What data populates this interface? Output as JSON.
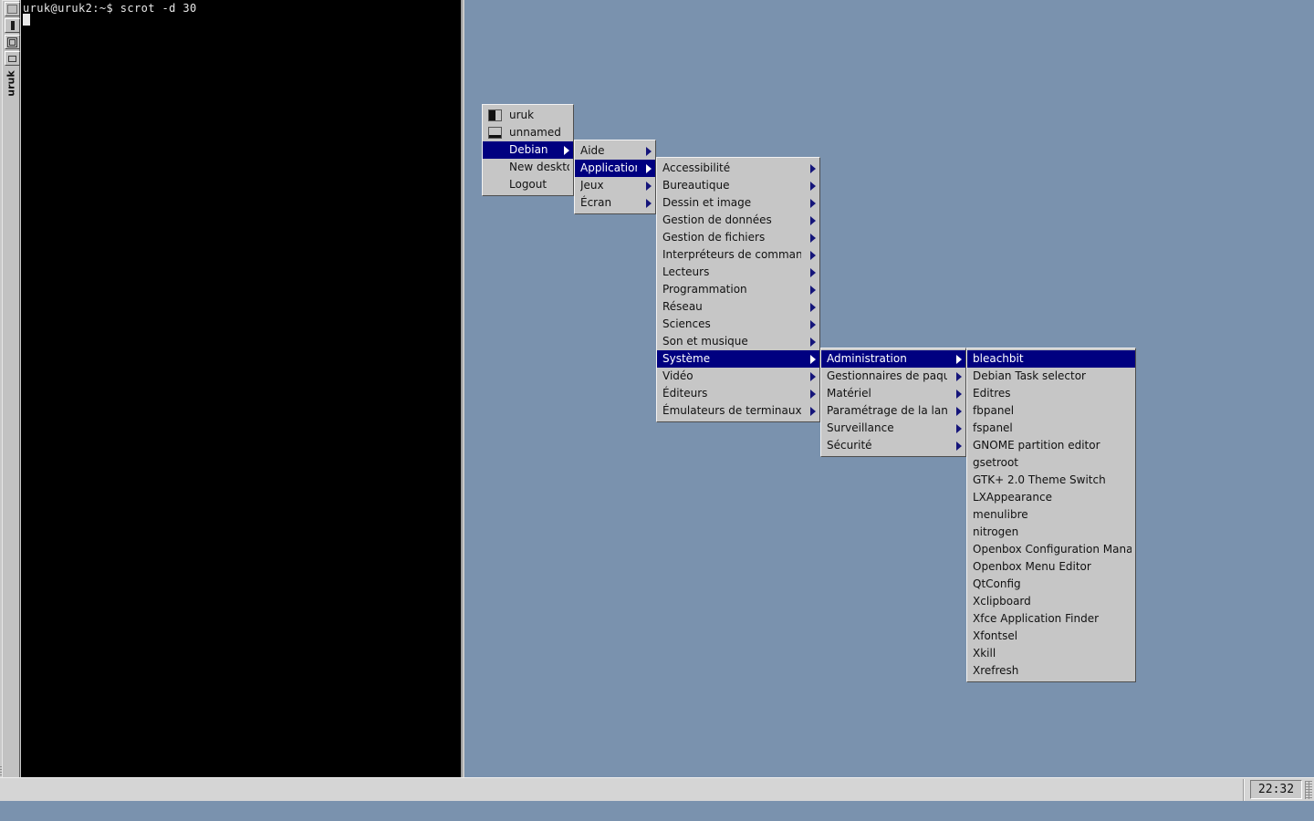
{
  "desktop": {
    "background_color": "#7a92ae"
  },
  "terminal": {
    "title": "uruk",
    "prompt_line": "uruk@uruk2:~$ scrot -d 30",
    "decorations": {
      "menu_button": "window-menu",
      "iconify_button": "iconify",
      "maximize_button": "maximize",
      "shade_button": "shade",
      "close_button": "✕"
    }
  },
  "menus": {
    "root": {
      "items": [
        {
          "label": "uruk",
          "icon": "window-icon-half",
          "submenu": false,
          "selected": false
        },
        {
          "label": "unnamed",
          "icon": "window-icon-bottom",
          "submenu": false,
          "selected": false
        },
        {
          "label": "Debian",
          "icon": null,
          "submenu": true,
          "selected": true
        },
        {
          "label": "New desktop",
          "icon": null,
          "submenu": false,
          "selected": false
        },
        {
          "label": "Logout",
          "icon": null,
          "submenu": false,
          "selected": false
        }
      ]
    },
    "debian": {
      "items": [
        {
          "label": "Aide",
          "submenu": true,
          "selected": false
        },
        {
          "label": "Applications",
          "submenu": true,
          "selected": true
        },
        {
          "label": "Jeux",
          "submenu": true,
          "selected": false
        },
        {
          "label": "Écran",
          "submenu": true,
          "selected": false
        }
      ]
    },
    "applications": {
      "items": [
        {
          "label": "Accessibilité",
          "submenu": true,
          "selected": false
        },
        {
          "label": "Bureautique",
          "submenu": true,
          "selected": false
        },
        {
          "label": "Dessin et image",
          "submenu": true,
          "selected": false
        },
        {
          "label": "Gestion de données",
          "submenu": true,
          "selected": false
        },
        {
          "label": "Gestion de fichiers",
          "submenu": true,
          "selected": false
        },
        {
          "label": "Interpréteurs de commandes",
          "submenu": true,
          "selected": false
        },
        {
          "label": "Lecteurs",
          "submenu": true,
          "selected": false
        },
        {
          "label": "Programmation",
          "submenu": true,
          "selected": false
        },
        {
          "label": "Réseau",
          "submenu": true,
          "selected": false
        },
        {
          "label": "Sciences",
          "submenu": true,
          "selected": false
        },
        {
          "label": "Son et musique",
          "submenu": true,
          "selected": false
        },
        {
          "label": "Système",
          "submenu": true,
          "selected": true
        },
        {
          "label": "Vidéo",
          "submenu": true,
          "selected": false
        },
        {
          "label": "Éditeurs",
          "submenu": true,
          "selected": false
        },
        {
          "label": "Émulateurs de terminaux",
          "submenu": true,
          "selected": false
        }
      ]
    },
    "systeme": {
      "items": [
        {
          "label": "Administration",
          "submenu": true,
          "selected": true
        },
        {
          "label": "Gestionnaires de paquets",
          "submenu": true,
          "selected": false
        },
        {
          "label": "Matériel",
          "submenu": true,
          "selected": false
        },
        {
          "label": "Paramétrage de la langue",
          "submenu": true,
          "selected": false
        },
        {
          "label": "Surveillance",
          "submenu": true,
          "selected": false
        },
        {
          "label": "Sécurité",
          "submenu": true,
          "selected": false
        }
      ]
    },
    "administration": {
      "items": [
        {
          "label": "bleachbit",
          "submenu": false,
          "selected": true
        },
        {
          "label": "Debian Task selector",
          "submenu": false,
          "selected": false
        },
        {
          "label": "Editres",
          "submenu": false,
          "selected": false
        },
        {
          "label": "fbpanel",
          "submenu": false,
          "selected": false
        },
        {
          "label": "fspanel",
          "submenu": false,
          "selected": false
        },
        {
          "label": "GNOME partition editor",
          "submenu": false,
          "selected": false
        },
        {
          "label": "gsetroot",
          "submenu": false,
          "selected": false
        },
        {
          "label": "GTK+ 2.0 Theme Switch",
          "submenu": false,
          "selected": false
        },
        {
          "label": "LXAppearance",
          "submenu": false,
          "selected": false
        },
        {
          "label": "menulibre",
          "submenu": false,
          "selected": false
        },
        {
          "label": "nitrogen",
          "submenu": false,
          "selected": false
        },
        {
          "label": "Openbox Configuration Manager",
          "submenu": false,
          "selected": false
        },
        {
          "label": "Openbox Menu Editor",
          "submenu": false,
          "selected": false
        },
        {
          "label": "QtConfig",
          "submenu": false,
          "selected": false
        },
        {
          "label": "Xclipboard",
          "submenu": false,
          "selected": false
        },
        {
          "label": "Xfce Application Finder",
          "submenu": false,
          "selected": false
        },
        {
          "label": "Xfontsel",
          "submenu": false,
          "selected": false
        },
        {
          "label": "Xkill",
          "submenu": false,
          "selected": false
        },
        {
          "label": "Xrefresh",
          "submenu": false,
          "selected": false
        }
      ]
    }
  },
  "taskbar": {
    "clock": "22:32"
  },
  "colors": {
    "menu_face": "#c6c6c6",
    "menu_highlight": "#000080",
    "menu_highlight_text": "#ffffff",
    "desktop": "#7a92ae",
    "taskbar": "#d5d5d5",
    "terminal_bg": "#000000",
    "terminal_fg": "#e8e8e8"
  }
}
